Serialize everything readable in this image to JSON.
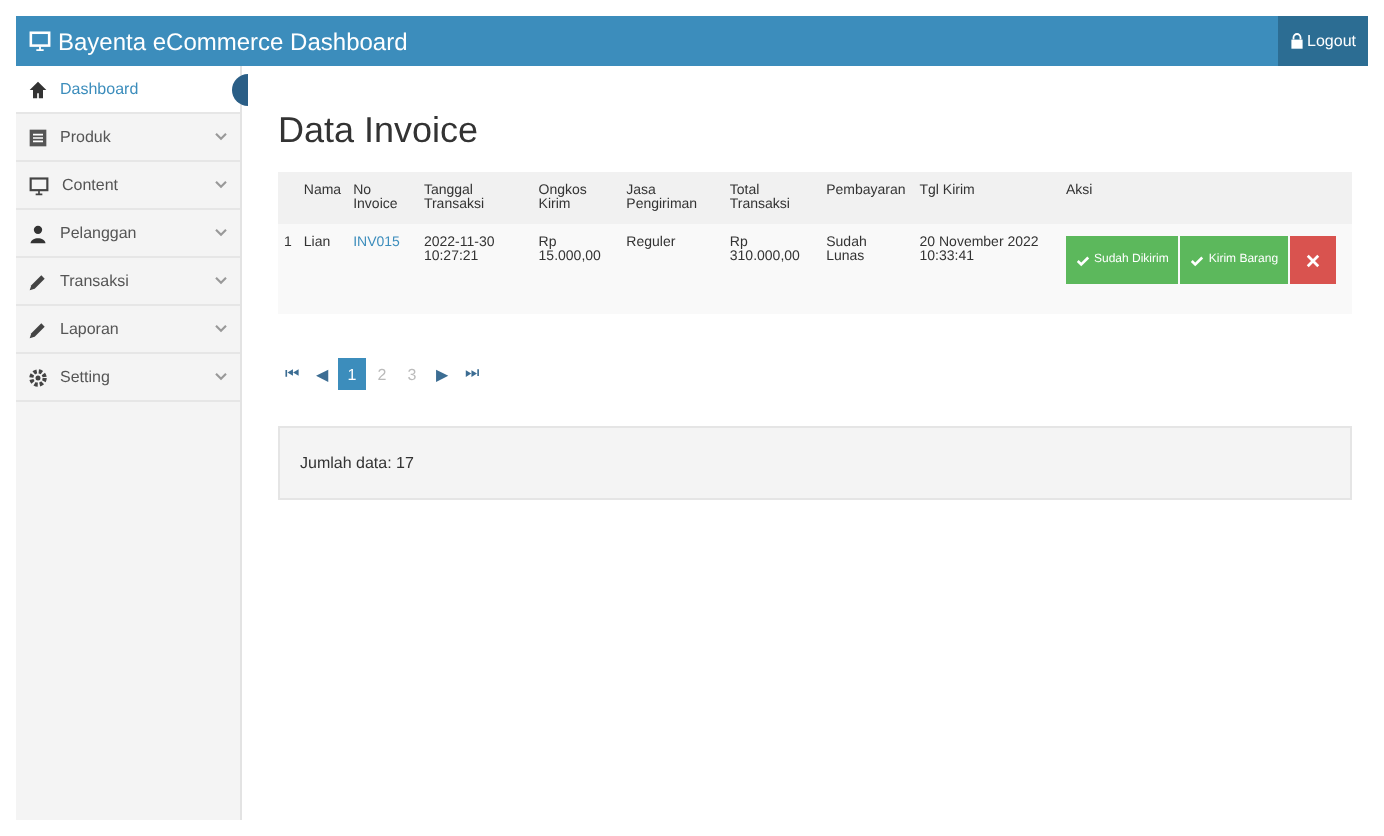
{
  "header": {
    "title": "Bayenta eCommerce Dashboard",
    "logout": "Logout"
  },
  "sidebar": {
    "items": [
      {
        "label": "Dashboard",
        "expandable": false,
        "selected": true
      },
      {
        "label": "Produk",
        "expandable": true,
        "selected": false
      },
      {
        "label": "Content",
        "expandable": true,
        "selected": false
      },
      {
        "label": "Pelanggan",
        "expandable": true,
        "selected": false
      },
      {
        "label": "Transaksi",
        "expandable": true,
        "selected": false
      },
      {
        "label": "Laporan",
        "expandable": true,
        "selected": false
      },
      {
        "label": "Setting",
        "expandable": true,
        "selected": false
      }
    ]
  },
  "page_title": "Data Invoice",
  "table": {
    "columns": [
      "",
      "Nama",
      "No Invoice",
      "Tanggal Transaksi",
      "Ongkos Kirim",
      "Jasa Pengiriman",
      "Total Transaksi",
      "Pembayaran",
      "Tgl Kirim",
      "Aksi"
    ],
    "rows": [
      {
        "cells": [
          "1",
          "Lian",
          "INV015",
          "2022-11-30 10:27:21",
          "Rp 15.000,00",
          "Reguler",
          "Rp 310.000,00",
          "Sudah Lunas",
          "20 November 2022 10:33:41"
        ],
        "actions": [
          {
            "kind": "success",
            "label": "Sudah Dikirim"
          },
          {
            "kind": "success",
            "label": "Kirim Barang"
          },
          {
            "kind": "danger"
          }
        ]
      }
    ]
  },
  "pagination": [
    {
      "label": "⏮",
      "selected": false,
      "disabled": false
    },
    {
      "label": "◀",
      "selected": false,
      "disabled": false
    },
    {
      "label": "1",
      "selected": true,
      "disabled": false
    },
    {
      "label": "2",
      "selected": false,
      "disabled": true
    },
    {
      "label": "3",
      "selected": false,
      "disabled": true
    },
    {
      "label": "▶",
      "selected": false,
      "disabled": false
    },
    {
      "label": "⏭",
      "selected": false,
      "disabled": false
    }
  ],
  "footer": "Jumlah data: 17"
}
